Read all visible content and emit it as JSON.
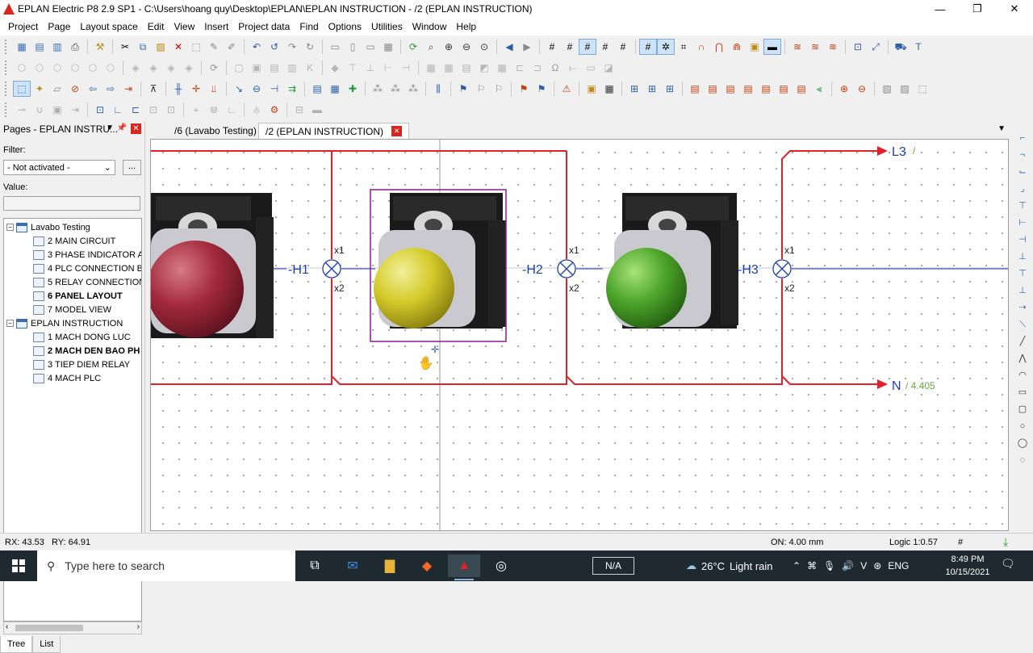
{
  "window": {
    "title": "EPLAN Electric P8 2.9 SP1 - C:\\Users\\hoang quy\\Desktop\\EPLAN\\EPLAN INSTRUCTION - /2 (EPLAN INSTRUCTION)",
    "controls": {
      "minimize": "—",
      "maximize": "❐",
      "close": "✕"
    }
  },
  "menu": [
    "Project",
    "Page",
    "Layout space",
    "Edit",
    "View",
    "Insert",
    "Project data",
    "Find",
    "Options",
    "Utilities",
    "Window",
    "Help"
  ],
  "left_panel": {
    "header": "Pages - EPLAN INSTRU...",
    "filter_label": "Filter:",
    "filter_value": "- Not activated -",
    "filter_more": "...",
    "value_label": "Value:",
    "tree": [
      {
        "label": "Lavabo Testing",
        "type": "project",
        "expanded": "−"
      },
      {
        "label": "2 MAIN CIRCUIT",
        "type": "page"
      },
      {
        "label": "3 PHASE INDICATOR A",
        "type": "page"
      },
      {
        "label": "4 PLC CONNECTION B",
        "type": "page"
      },
      {
        "label": "5 RELAY CONNECTION",
        "type": "page"
      },
      {
        "label": "6 PANEL LAYOUT",
        "type": "page",
        "bold": true
      },
      {
        "label": "7 MODEL VIEW",
        "type": "page"
      },
      {
        "label": "EPLAN INSTRUCTION",
        "type": "project",
        "expanded": "−"
      },
      {
        "label": "1 MACH DONG LUC",
        "type": "page"
      },
      {
        "label": "2 MACH DEN BAO PH",
        "type": "page",
        "bold": true
      },
      {
        "label": "3 TIEP DIEM RELAY",
        "type": "page"
      },
      {
        "label": "4 MACH PLC",
        "type": "page"
      }
    ],
    "tabs": [
      "Tree",
      "List"
    ]
  },
  "doc_tabs": [
    {
      "label": "/6 (Lavabo Testing)",
      "active": false
    },
    {
      "label": "/2 (EPLAN INSTRUCTION)",
      "active": true
    }
  ],
  "schematic": {
    "phase_label": "L3",
    "phase_ref": "/",
    "neutral_label": "N",
    "neutral_ref": "/ 4.405",
    "devices": [
      {
        "tag": "-H1",
        "pin_top": "x1",
        "pin_bottom": "x2",
        "lamp_color": "red"
      },
      {
        "tag": "-H2",
        "pin_top": "x1",
        "pin_bottom": "x2",
        "lamp_color": "yellow"
      },
      {
        "tag": "-H3",
        "pin_top": "x1",
        "pin_bottom": "x2",
        "lamp_color": "green"
      }
    ],
    "colors": {
      "wire": "#e0202a",
      "tag": "#1a3fb0",
      "ref": "#6aa83a",
      "selection": "#8b1a8b"
    }
  },
  "status": {
    "rx": "RX: 43.53",
    "ry": "RY: 64.91",
    "on": "ON: 4.00 mm",
    "logic": "Logic 1:0.57",
    "hash": "#"
  },
  "taskbar": {
    "search_placeholder": "Type here to search",
    "na": "N/A",
    "temperature": "26°C",
    "weather": "Light rain",
    "language": "ENG",
    "time": "8:49 PM",
    "date": "10/15/2021"
  }
}
